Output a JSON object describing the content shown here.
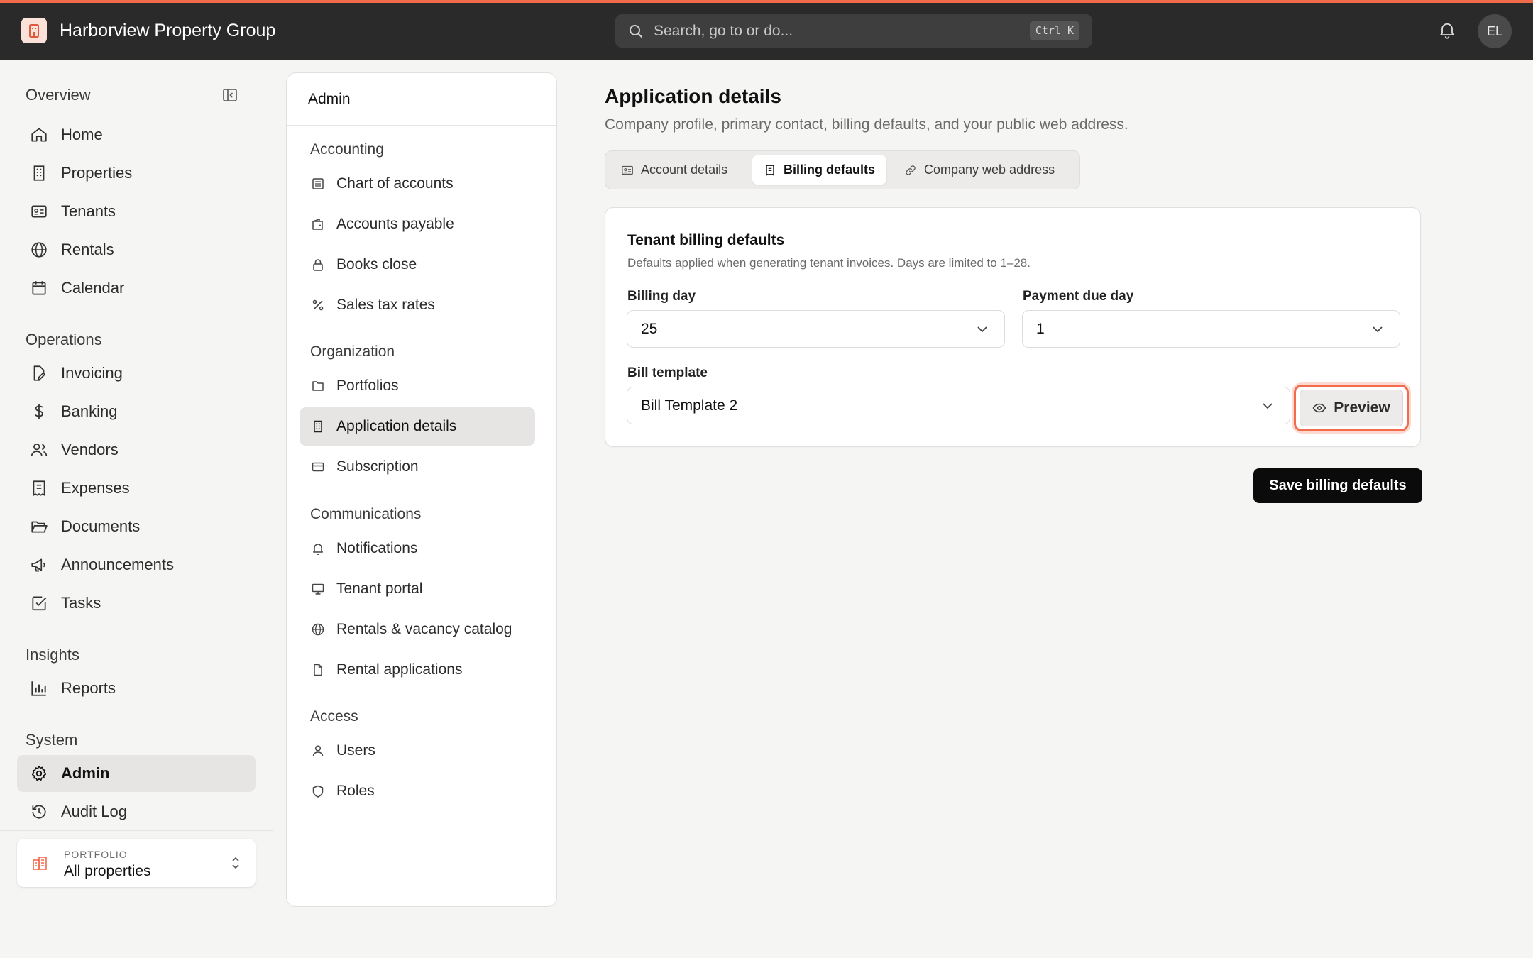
{
  "app": {
    "title": "Harborview Property Group",
    "user_initials": "EL",
    "accent_color": "#f26b4b"
  },
  "search": {
    "placeholder": "Search, go to or do...",
    "shortcut": "Ctrl K"
  },
  "sidebar": {
    "sections": [
      {
        "title": "Overview",
        "items": [
          {
            "label": "Home",
            "icon": "home-icon"
          },
          {
            "label": "Properties",
            "icon": "building-icon"
          },
          {
            "label": "Tenants",
            "icon": "id-card-icon"
          },
          {
            "label": "Rentals",
            "icon": "globe-icon"
          },
          {
            "label": "Calendar",
            "icon": "calendar-icon"
          }
        ]
      },
      {
        "title": "Operations",
        "items": [
          {
            "label": "Invoicing",
            "icon": "file-edit-icon"
          },
          {
            "label": "Banking",
            "icon": "dollar-icon"
          },
          {
            "label": "Vendors",
            "icon": "users-icon"
          },
          {
            "label": "Expenses",
            "icon": "receipt-icon"
          },
          {
            "label": "Documents",
            "icon": "folder-open-icon"
          },
          {
            "label": "Announcements",
            "icon": "megaphone-icon"
          },
          {
            "label": "Tasks",
            "icon": "check-square-icon"
          }
        ]
      },
      {
        "title": "Insights",
        "items": [
          {
            "label": "Reports",
            "icon": "bar-chart-icon"
          }
        ]
      },
      {
        "title": "System",
        "items": [
          {
            "label": "Admin",
            "icon": "gear-icon",
            "active": true
          },
          {
            "label": "Audit Log",
            "icon": "history-icon"
          }
        ]
      }
    ],
    "portfolio": {
      "caption": "PORTFOLIO",
      "value": "All properties"
    }
  },
  "admin_panel": {
    "title": "Admin",
    "sections": [
      {
        "title": "Accounting",
        "items": [
          {
            "label": "Chart of accounts",
            "icon": "list-icon"
          },
          {
            "label": "Accounts payable",
            "icon": "wallet-icon"
          },
          {
            "label": "Books close",
            "icon": "lock-icon"
          },
          {
            "label": "Sales tax rates",
            "icon": "percent-icon"
          }
        ]
      },
      {
        "title": "Organization",
        "items": [
          {
            "label": "Portfolios",
            "icon": "folder-icon"
          },
          {
            "label": "Application details",
            "icon": "building-icon",
            "active": true
          },
          {
            "label": "Subscription",
            "icon": "credit-card-icon"
          }
        ]
      },
      {
        "title": "Communications",
        "items": [
          {
            "label": "Notifications",
            "icon": "bell-icon"
          },
          {
            "label": "Tenant portal",
            "icon": "monitor-icon"
          },
          {
            "label": "Rentals & vacancy catalog",
            "icon": "globe-icon"
          },
          {
            "label": "Rental applications",
            "icon": "file-icon"
          }
        ]
      },
      {
        "title": "Access",
        "items": [
          {
            "label": "Users",
            "icon": "user-icon"
          },
          {
            "label": "Roles",
            "icon": "shield-icon"
          }
        ]
      }
    ]
  },
  "main": {
    "title": "Application details",
    "subtitle": "Company profile, primary contact, billing defaults, and your public web address.",
    "tabs": [
      {
        "label": "Account details",
        "icon": "id-card-icon"
      },
      {
        "label": "Billing defaults",
        "icon": "receipt-icon",
        "active": true
      },
      {
        "label": "Company web address",
        "icon": "link-icon"
      }
    ],
    "card": {
      "title": "Tenant billing defaults",
      "subtitle": "Defaults applied when generating tenant invoices. Days are limited to 1–28.",
      "billing_day": {
        "label": "Billing day",
        "value": "25"
      },
      "payment_due_day": {
        "label": "Payment due day",
        "value": "1"
      },
      "bill_template": {
        "label": "Bill template",
        "value": "Bill Template 2"
      },
      "preview_label": "Preview"
    },
    "save_label": "Save billing defaults"
  }
}
